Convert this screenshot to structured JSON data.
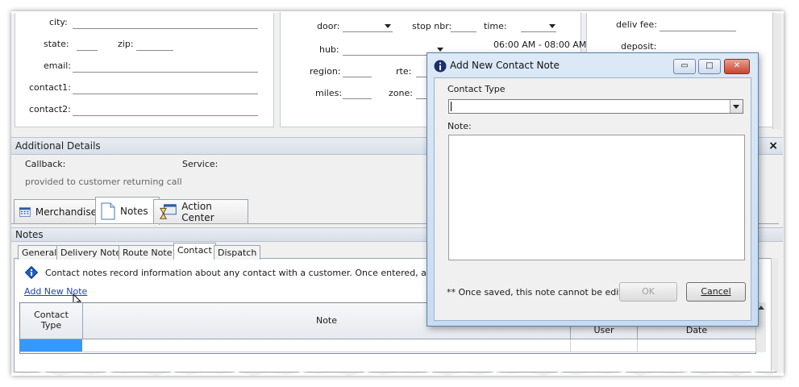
{
  "form": {
    "city_label": "city:",
    "state_label": "state:",
    "zip_label": "zip:",
    "email_label": "email:",
    "contact1_label": "contact1:",
    "contact2_label": "contact2:",
    "door_label": "door:",
    "stop_nbr_label": "stop nbr:",
    "time_label": "time:",
    "time_value": "06:00 AM - 08:00 AM",
    "hub_label": "hub:",
    "region_label": "region:",
    "rte_label": "rte:",
    "miles_label": "miles:",
    "zone_label": "zone:",
    "deliv_fee_label": "deliv fee:",
    "deposit_label": "deposit:"
  },
  "additional_details": {
    "title": "Additional Details",
    "close": "×",
    "callback_label": "Callback:",
    "service_label": "Service:",
    "note_text": "provided to customer returning call"
  },
  "main_tabs": [
    {
      "label": "Merchandise",
      "icon": "grid-icon"
    },
    {
      "label": "Notes",
      "icon": "document-icon"
    },
    {
      "label": "Action Center",
      "icon": "hourglass-icon"
    }
  ],
  "notes": {
    "title": "Notes",
    "tabs": [
      "General",
      "Delivery Note",
      "Route Note",
      "Contact",
      "Dispatch"
    ],
    "active_tab": "Contact",
    "info_text": "Contact notes record information about any contact with a customer.  Once entered, a contact no",
    "add_link": "Add New Note",
    "columns": {
      "contact_type": "Contact Type",
      "note": "Note",
      "user": "User",
      "date": "Date"
    }
  },
  "dialog": {
    "title": "Add New Contact Note",
    "contact_type_label": "Contact Type",
    "contact_type_value": "",
    "note_label": "Note:",
    "note_value": "",
    "footer_text": "** Once saved, this note cannot be edited",
    "ok_label": "OK",
    "cancel_label": "Cancel",
    "minimize": "▭",
    "maximize": "□",
    "close": "✕"
  },
  "colors": {
    "link": "#1f3fbf",
    "selection": "#3399ff",
    "info_icon": "#1f5fbf"
  }
}
